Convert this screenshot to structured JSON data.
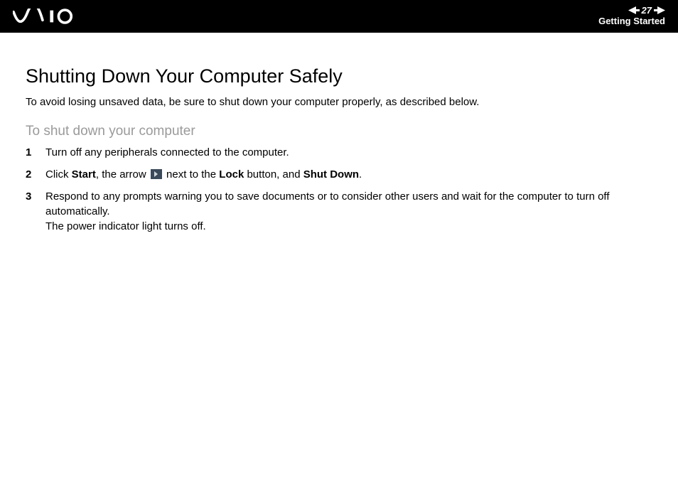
{
  "header": {
    "page_number": "27",
    "section": "Getting Started"
  },
  "content": {
    "title": "Shutting Down Your Computer Safely",
    "intro": "To avoid losing unsaved data, be sure to shut down your computer properly, as described below.",
    "subhead": "To shut down your computer",
    "steps": {
      "s1": "Turn off any peripherals connected to the computer.",
      "s2_a": "Click ",
      "s2_b1": "Start",
      "s2_c": ", the arrow ",
      "s2_d": " next to the ",
      "s2_b2": "Lock",
      "s2_e": " button, and ",
      "s2_b3": "Shut Down",
      "s2_f": ".",
      "s3_a": "Respond to any prompts warning you to save documents or to consider other users and wait for the computer to turn off automatically.",
      "s3_b": "The power indicator light turns off."
    }
  }
}
